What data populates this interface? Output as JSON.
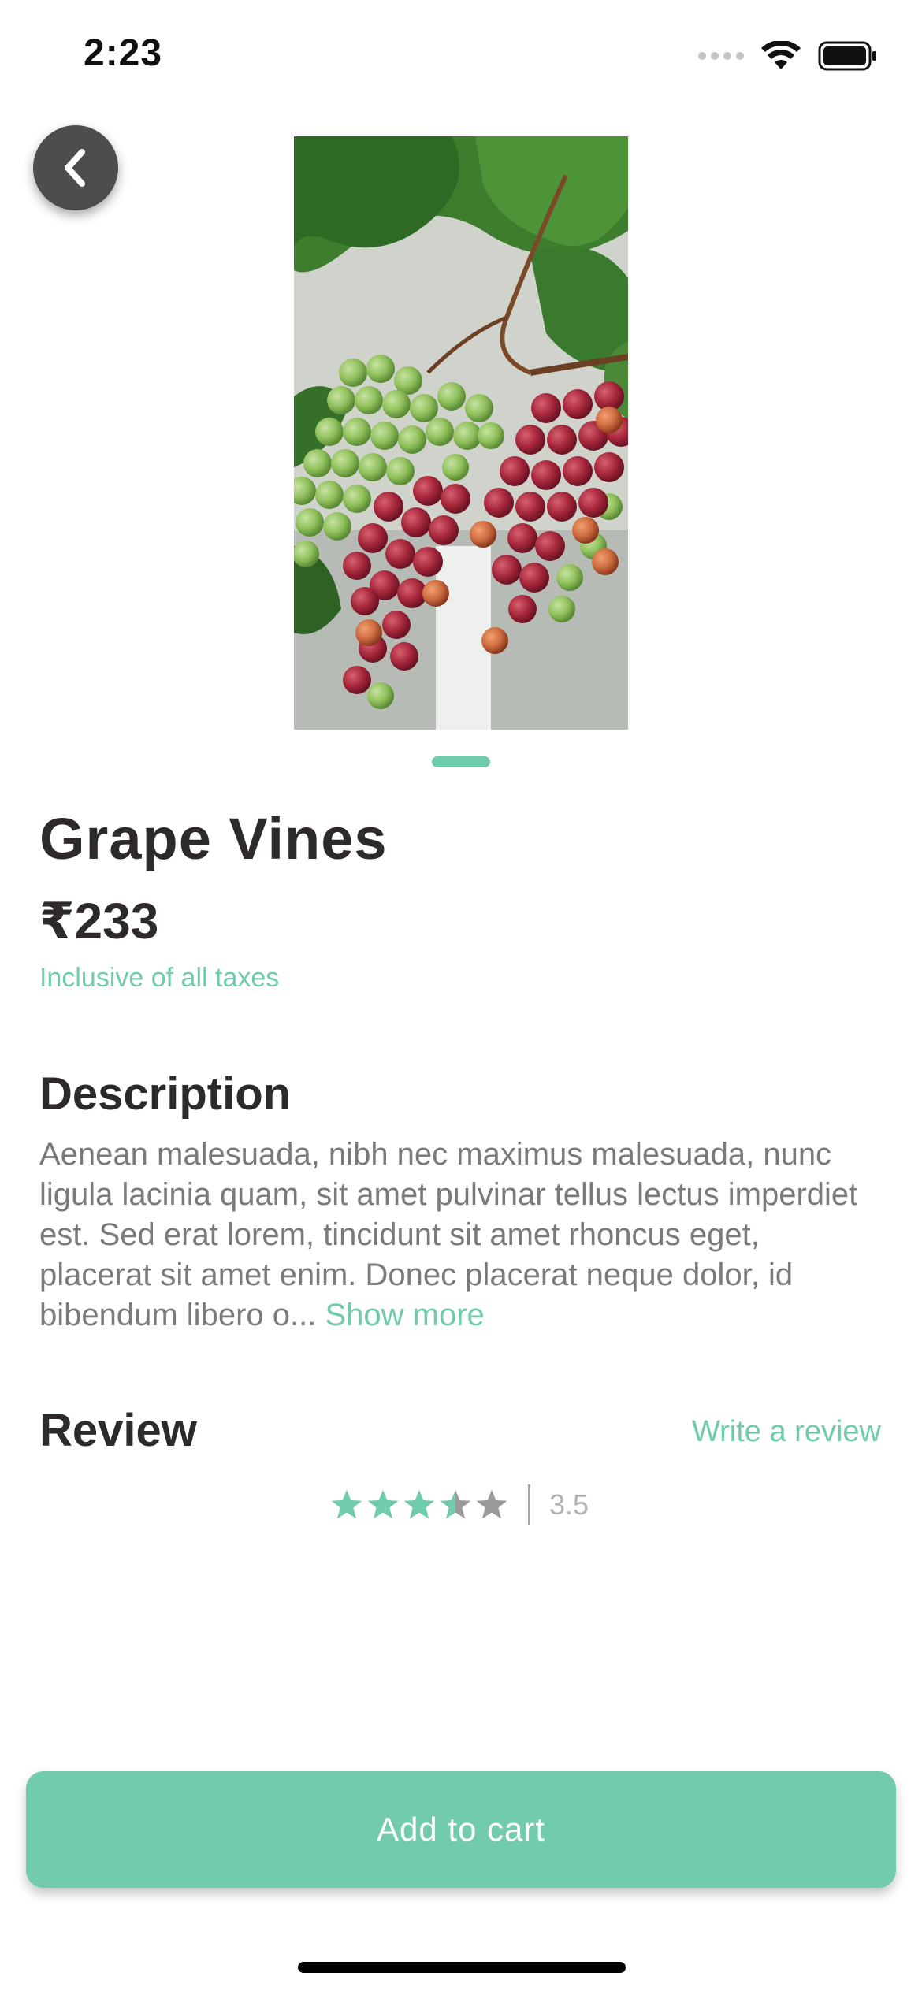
{
  "status_bar": {
    "time": "2:23"
  },
  "product": {
    "name": "Grape Vines",
    "price": "₹233",
    "tax_note": "Inclusive of all taxes"
  },
  "description": {
    "heading": "Description",
    "text": "Aenean malesuada, nibh nec maximus malesuada, nunc ligula lacinia quam, sit amet pulvinar tellus lectus imperdiet est. Sed erat lorem, tincidunt sit amet rhoncus eget, placerat sit amet enim. Donec placerat neque dolor, id bibendum libero o...",
    "show_more_label": "Show more"
  },
  "review": {
    "heading": "Review",
    "write_review_label": "Write a review",
    "rating_value": "3.5",
    "rating_max": 5
  },
  "cart": {
    "button_label": "Add to cart"
  },
  "colors": {
    "accent": "#6fcbab",
    "button": "#72cbab",
    "text_dark": "#2f2a2a",
    "text_muted": "#7a7a7a"
  }
}
